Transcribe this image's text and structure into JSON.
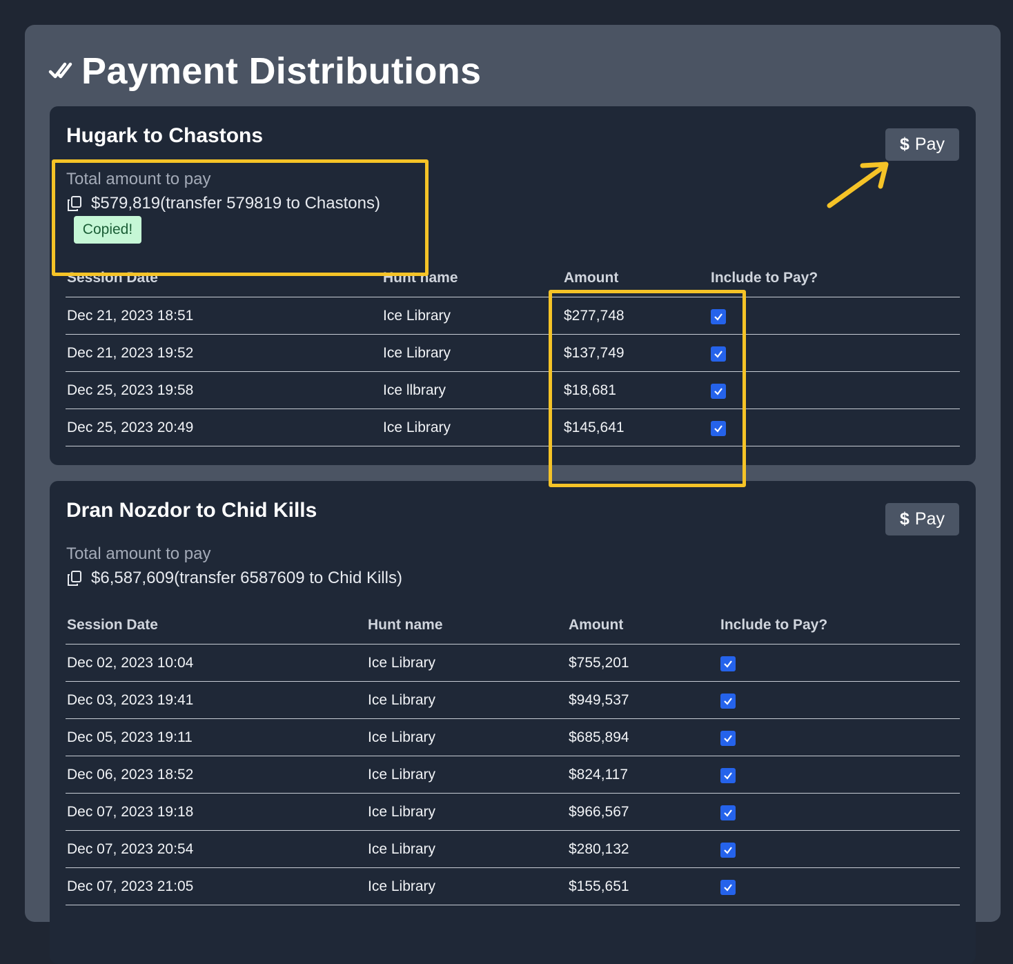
{
  "page": {
    "title": "Payment Distributions"
  },
  "colors": {
    "highlight": "#f5c327",
    "checkbox": "#2563eb",
    "copied_bg": "#c6f7d6"
  },
  "cards": [
    {
      "title": "Hugark to Chastons",
      "pay_label": "Pay",
      "total_label": "Total amount to pay",
      "total_value": "$579,819(transfer 579819 to Chastons)",
      "copied_label": "Copied!",
      "columns": [
        "Session Date",
        "Hunt name",
        "Amount",
        "Include to Pay?"
      ],
      "rows": [
        {
          "date": "Dec 21, 2023 18:51",
          "hunt": "Ice Library",
          "amount": "$277,748",
          "include": true
        },
        {
          "date": "Dec 21, 2023 19:52",
          "hunt": "Ice Library",
          "amount": "$137,749",
          "include": true
        },
        {
          "date": "Dec 25, 2023 19:58",
          "hunt": "Ice llbrary",
          "amount": "$18,681",
          "include": true
        },
        {
          "date": "Dec 25, 2023 20:49",
          "hunt": "Ice Library",
          "amount": "$145,641",
          "include": true
        }
      ]
    },
    {
      "title": "Dran Nozdor to Chid Kills",
      "pay_label": "Pay",
      "total_label": "Total amount to pay",
      "total_value": "$6,587,609(transfer 6587609 to Chid Kills)",
      "columns": [
        "Session Date",
        "Hunt name",
        "Amount",
        "Include to Pay?"
      ],
      "rows": [
        {
          "date": "Dec 02, 2023 10:04",
          "hunt": "Ice Library",
          "amount": "$755,201",
          "include": true
        },
        {
          "date": "Dec 03, 2023 19:41",
          "hunt": "Ice Library",
          "amount": "$949,537",
          "include": true
        },
        {
          "date": "Dec 05, 2023 19:11",
          "hunt": "Ice Library",
          "amount": "$685,894",
          "include": true
        },
        {
          "date": "Dec 06, 2023 18:52",
          "hunt": "Ice Library",
          "amount": "$824,117",
          "include": true
        },
        {
          "date": "Dec 07, 2023 19:18",
          "hunt": "Ice Library",
          "amount": "$966,567",
          "include": true
        },
        {
          "date": "Dec 07, 2023 20:54",
          "hunt": "Ice Library",
          "amount": "$280,132",
          "include": true
        },
        {
          "date": "Dec 07, 2023 21:05",
          "hunt": "Ice Library",
          "amount": "$155,651",
          "include": true
        }
      ]
    }
  ]
}
